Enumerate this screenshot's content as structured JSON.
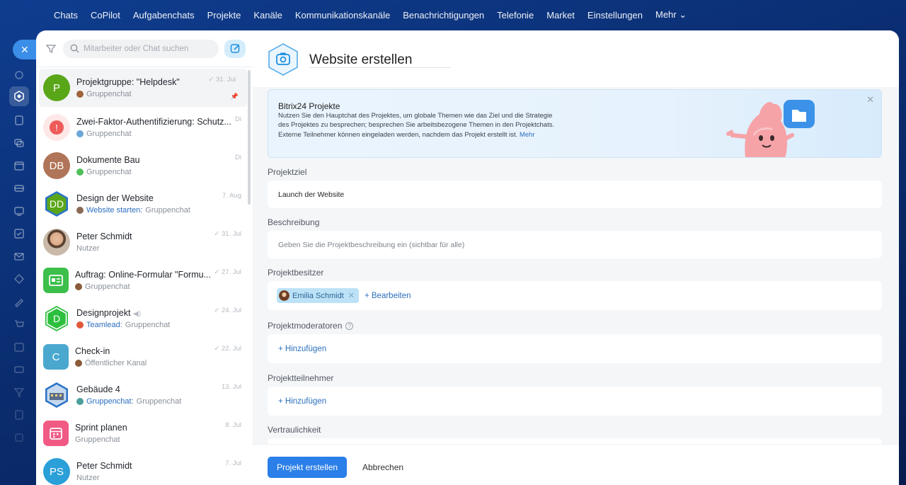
{
  "nav": [
    "Chats",
    "CoPilot",
    "Aufgabenchats",
    "Projekte",
    "Kanäle",
    "Kommunikationskanäle",
    "Benachrichtigungen",
    "Telefonie",
    "Market",
    "Einstellungen",
    "Mehr ⌄"
  ],
  "close_label": "✕",
  "search": {
    "placeholder": "Mitarbeiter oder Chat suchen"
  },
  "chats": [
    {
      "title": "Projektgruppe: \"Helpdesk\"",
      "sub": "Gruppenchat",
      "sub_hl": "",
      "date": "✓ 31. Jul",
      "avatar": "P",
      "avatar_color": "#5aa619"
    },
    {
      "title": "Zwei-Faktor-Authentifizierung: Schutz...",
      "sub": "Gruppenchat",
      "sub_hl": "",
      "date": "Di",
      "avatar": "!",
      "avatar_color": "#ffe6e6"
    },
    {
      "title": "Dokumente Bau",
      "sub": "Gruppenchat",
      "sub_hl": "",
      "date": "Di",
      "avatar": "DB",
      "avatar_color": "#b07458"
    },
    {
      "title": "Design der Website",
      "sub": "Gruppenchat",
      "sub_hl": "Website starten:",
      "date": "7. Aug",
      "avatar": "DD",
      "avatar_color": "#5aa619"
    },
    {
      "title": "Peter Schmidt",
      "sub": "Nutzer",
      "sub_hl": "",
      "date": "✓ 31. Jul",
      "avatar": "",
      "avatar_color": "#c9a98d"
    },
    {
      "title": "Auftrag: Online-Formular \"Formu...",
      "sub": "Gruppenchat",
      "sub_hl": "",
      "date": "✓ 27. Jul",
      "avatar": "",
      "avatar_color": "#3dbf4b"
    },
    {
      "title": "Designprojekt",
      "sub": "Gruppenchat",
      "sub_hl": "Teamlead:",
      "date": "✓ 24. Jul",
      "avatar": "D",
      "avatar_color": "#2dbf3e"
    },
    {
      "title": "Check-in",
      "sub": "Öffentlicher Kanal",
      "sub_hl": "",
      "date": "✓ 22. Jul",
      "avatar": "C",
      "avatar_color": "#4aa8cf"
    },
    {
      "title": "Gebäude 4",
      "sub": "Gruppenchat",
      "sub_hl": "Gruppenchat:",
      "date": "13. Jul",
      "avatar": "",
      "avatar_color": "#5a7fb4"
    },
    {
      "title": "Sprint planen",
      "sub": "Gruppenchat",
      "sub_hl": "",
      "date": "8. Jul",
      "avatar": "",
      "avatar_color": "#f05a84"
    },
    {
      "title": "Peter Schmidt",
      "sub": "Nutzer",
      "sub_hl": "",
      "date": "7. Jul",
      "avatar": "PS",
      "avatar_color": "#2a9fd8"
    }
  ],
  "header": {
    "title": "Website erstellen"
  },
  "banner": {
    "title": "Bitrix24 Projekte",
    "text": "Nutzen Sie den Hauptchat des Projektes, um globale Themen wie das Ziel und die Strategie des Projektes zu besprechen; besprechen Sie arbeitsbezogene Themen in den Projektchats. Externe Teilnehmer können eingeladen werden, nachdem das Projekt erstellt ist.",
    "more": "Mehr",
    "close": "✕"
  },
  "form": {
    "goal_label": "Projektziel",
    "goal_value": "Launch der Website",
    "desc_label": "Beschreibung",
    "desc_placeholder": "Geben Sie die Projektbeschreibung ein (sichtbar für alle)",
    "owner_label": "Projektbesitzer",
    "owner_chip": "Emilia Schmidt",
    "owner_edit": "+ Bearbeiten",
    "moderators_label": "Projektmoderatoren",
    "moderators_add": "+ Hinzufügen",
    "members_label": "Projektteilnehmer",
    "members_add": "+ Hinzufügen",
    "privacy_label": "Vertraulichkeit"
  },
  "footer": {
    "create": "Projekt erstellen",
    "cancel": "Abbrechen"
  },
  "colors": {
    "accent": "#2b7fe8",
    "link": "#2b6fbe"
  }
}
